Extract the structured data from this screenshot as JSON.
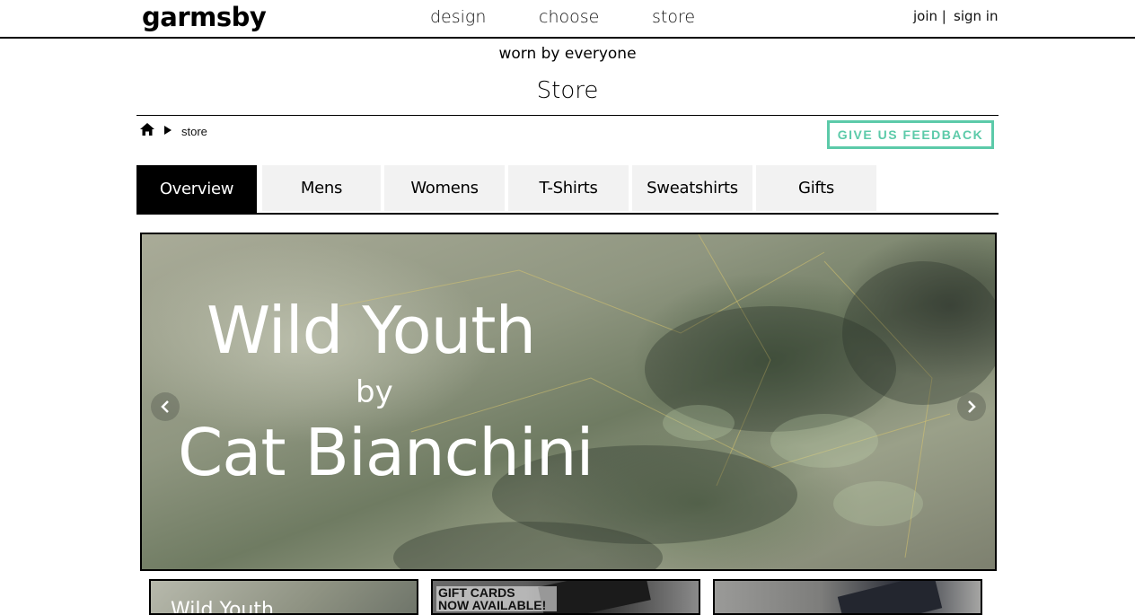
{
  "header": {
    "logo": "garmsby",
    "nav": [
      "design",
      "choose",
      "store"
    ],
    "join": "join |",
    "sign_in": "sign in"
  },
  "tagline": "worn by everyone",
  "page_title": "Store",
  "breadcrumb": {
    "current": "store"
  },
  "feedback_label": "GIVE US FEEDBACK",
  "tabs": [
    "Overview",
    "Mens",
    "Womens",
    "T-Shirts",
    "Sweatshirts",
    "Gifts"
  ],
  "active_tab": "Overview",
  "hero": {
    "line1": "Wild Youth",
    "line2": "by",
    "line3": "Cat Bianchini"
  },
  "thumbnails": {
    "first": "Wild Youth",
    "second_line1": "GIFT CARDS",
    "second_line2": "NOW AVAILABLE!"
  },
  "colors": {
    "accent": "#5ccaa9",
    "active_tab": "#000000",
    "tab_bg": "#f2f2f2"
  }
}
